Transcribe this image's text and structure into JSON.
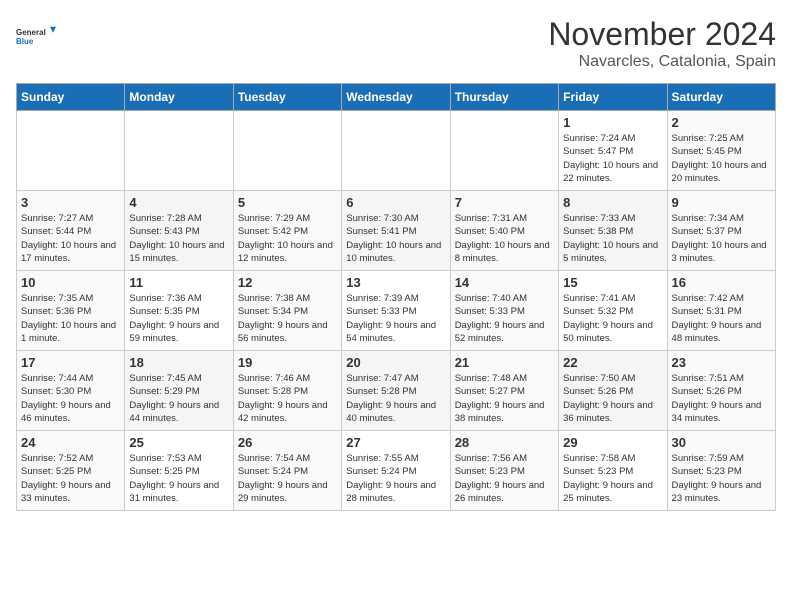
{
  "logo": {
    "line1": "General",
    "line2": "Blue"
  },
  "title": "November 2024",
  "location": "Navarcles, Catalonia, Spain",
  "weekdays": [
    "Sunday",
    "Monday",
    "Tuesday",
    "Wednesday",
    "Thursday",
    "Friday",
    "Saturday"
  ],
  "weeks": [
    [
      {
        "day": "",
        "info": ""
      },
      {
        "day": "",
        "info": ""
      },
      {
        "day": "",
        "info": ""
      },
      {
        "day": "",
        "info": ""
      },
      {
        "day": "",
        "info": ""
      },
      {
        "day": "1",
        "info": "Sunrise: 7:24 AM\nSunset: 5:47 PM\nDaylight: 10 hours and 22 minutes."
      },
      {
        "day": "2",
        "info": "Sunrise: 7:25 AM\nSunset: 5:45 PM\nDaylight: 10 hours and 20 minutes."
      }
    ],
    [
      {
        "day": "3",
        "info": "Sunrise: 7:27 AM\nSunset: 5:44 PM\nDaylight: 10 hours and 17 minutes."
      },
      {
        "day": "4",
        "info": "Sunrise: 7:28 AM\nSunset: 5:43 PM\nDaylight: 10 hours and 15 minutes."
      },
      {
        "day": "5",
        "info": "Sunrise: 7:29 AM\nSunset: 5:42 PM\nDaylight: 10 hours and 12 minutes."
      },
      {
        "day": "6",
        "info": "Sunrise: 7:30 AM\nSunset: 5:41 PM\nDaylight: 10 hours and 10 minutes."
      },
      {
        "day": "7",
        "info": "Sunrise: 7:31 AM\nSunset: 5:40 PM\nDaylight: 10 hours and 8 minutes."
      },
      {
        "day": "8",
        "info": "Sunrise: 7:33 AM\nSunset: 5:38 PM\nDaylight: 10 hours and 5 minutes."
      },
      {
        "day": "9",
        "info": "Sunrise: 7:34 AM\nSunset: 5:37 PM\nDaylight: 10 hours and 3 minutes."
      }
    ],
    [
      {
        "day": "10",
        "info": "Sunrise: 7:35 AM\nSunset: 5:36 PM\nDaylight: 10 hours and 1 minute."
      },
      {
        "day": "11",
        "info": "Sunrise: 7:36 AM\nSunset: 5:35 PM\nDaylight: 9 hours and 59 minutes."
      },
      {
        "day": "12",
        "info": "Sunrise: 7:38 AM\nSunset: 5:34 PM\nDaylight: 9 hours and 56 minutes."
      },
      {
        "day": "13",
        "info": "Sunrise: 7:39 AM\nSunset: 5:33 PM\nDaylight: 9 hours and 54 minutes."
      },
      {
        "day": "14",
        "info": "Sunrise: 7:40 AM\nSunset: 5:33 PM\nDaylight: 9 hours and 52 minutes."
      },
      {
        "day": "15",
        "info": "Sunrise: 7:41 AM\nSunset: 5:32 PM\nDaylight: 9 hours and 50 minutes."
      },
      {
        "day": "16",
        "info": "Sunrise: 7:42 AM\nSunset: 5:31 PM\nDaylight: 9 hours and 48 minutes."
      }
    ],
    [
      {
        "day": "17",
        "info": "Sunrise: 7:44 AM\nSunset: 5:30 PM\nDaylight: 9 hours and 46 minutes."
      },
      {
        "day": "18",
        "info": "Sunrise: 7:45 AM\nSunset: 5:29 PM\nDaylight: 9 hours and 44 minutes."
      },
      {
        "day": "19",
        "info": "Sunrise: 7:46 AM\nSunset: 5:28 PM\nDaylight: 9 hours and 42 minutes."
      },
      {
        "day": "20",
        "info": "Sunrise: 7:47 AM\nSunset: 5:28 PM\nDaylight: 9 hours and 40 minutes."
      },
      {
        "day": "21",
        "info": "Sunrise: 7:48 AM\nSunset: 5:27 PM\nDaylight: 9 hours and 38 minutes."
      },
      {
        "day": "22",
        "info": "Sunrise: 7:50 AM\nSunset: 5:26 PM\nDaylight: 9 hours and 36 minutes."
      },
      {
        "day": "23",
        "info": "Sunrise: 7:51 AM\nSunset: 5:26 PM\nDaylight: 9 hours and 34 minutes."
      }
    ],
    [
      {
        "day": "24",
        "info": "Sunrise: 7:52 AM\nSunset: 5:25 PM\nDaylight: 9 hours and 33 minutes."
      },
      {
        "day": "25",
        "info": "Sunrise: 7:53 AM\nSunset: 5:25 PM\nDaylight: 9 hours and 31 minutes."
      },
      {
        "day": "26",
        "info": "Sunrise: 7:54 AM\nSunset: 5:24 PM\nDaylight: 9 hours and 29 minutes."
      },
      {
        "day": "27",
        "info": "Sunrise: 7:55 AM\nSunset: 5:24 PM\nDaylight: 9 hours and 28 minutes."
      },
      {
        "day": "28",
        "info": "Sunrise: 7:56 AM\nSunset: 5:23 PM\nDaylight: 9 hours and 26 minutes."
      },
      {
        "day": "29",
        "info": "Sunrise: 7:58 AM\nSunset: 5:23 PM\nDaylight: 9 hours and 25 minutes."
      },
      {
        "day": "30",
        "info": "Sunrise: 7:59 AM\nSunset: 5:23 PM\nDaylight: 9 hours and 23 minutes."
      }
    ]
  ]
}
